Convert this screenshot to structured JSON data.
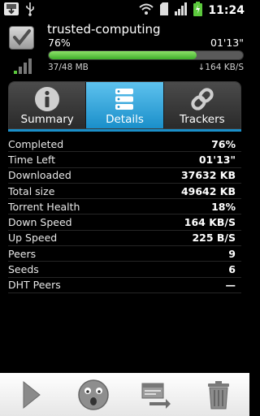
{
  "status_bar": {
    "time": "11:24",
    "icons": [
      "download-notification-icon",
      "usb-icon",
      "wifi-icon",
      "sd-card-icon",
      "cell-signal-icon",
      "battery-charging-icon"
    ]
  },
  "torrent": {
    "name": "trusted-computing",
    "percent": "76%",
    "progress": 0.76,
    "eta": "01'13\"",
    "size": "37/48 MB",
    "speed": "↓164 KB/S",
    "colors": {
      "progress": "#5cc93d",
      "accent": "#1a8fca"
    }
  },
  "tabs": [
    {
      "label": "Summary",
      "icon": "info-icon",
      "active": false
    },
    {
      "label": "Details",
      "icon": "server-list-icon",
      "active": true
    },
    {
      "label": "Trackers",
      "icon": "link-icon",
      "active": false
    }
  ],
  "details": [
    {
      "key": "Completed",
      "value": "76%"
    },
    {
      "key": "Time Left",
      "value": "01'13\""
    },
    {
      "key": "Downloaded",
      "value": "37632 KB"
    },
    {
      "key": "Total size",
      "value": "49642 KB"
    },
    {
      "key": "Torrent Health",
      "value": "18%"
    },
    {
      "key": "Down Speed",
      "value": "164 KB/S"
    },
    {
      "key": "Up Speed",
      "value": "225 B/S"
    },
    {
      "key": "Peers",
      "value": "9"
    },
    {
      "key": "Seeds",
      "value": "6"
    },
    {
      "key": "DHT Peers",
      "value": "—"
    }
  ],
  "toolbar": [
    "play-icon",
    "sad-face-icon",
    "move-file-icon",
    "trash-icon"
  ]
}
